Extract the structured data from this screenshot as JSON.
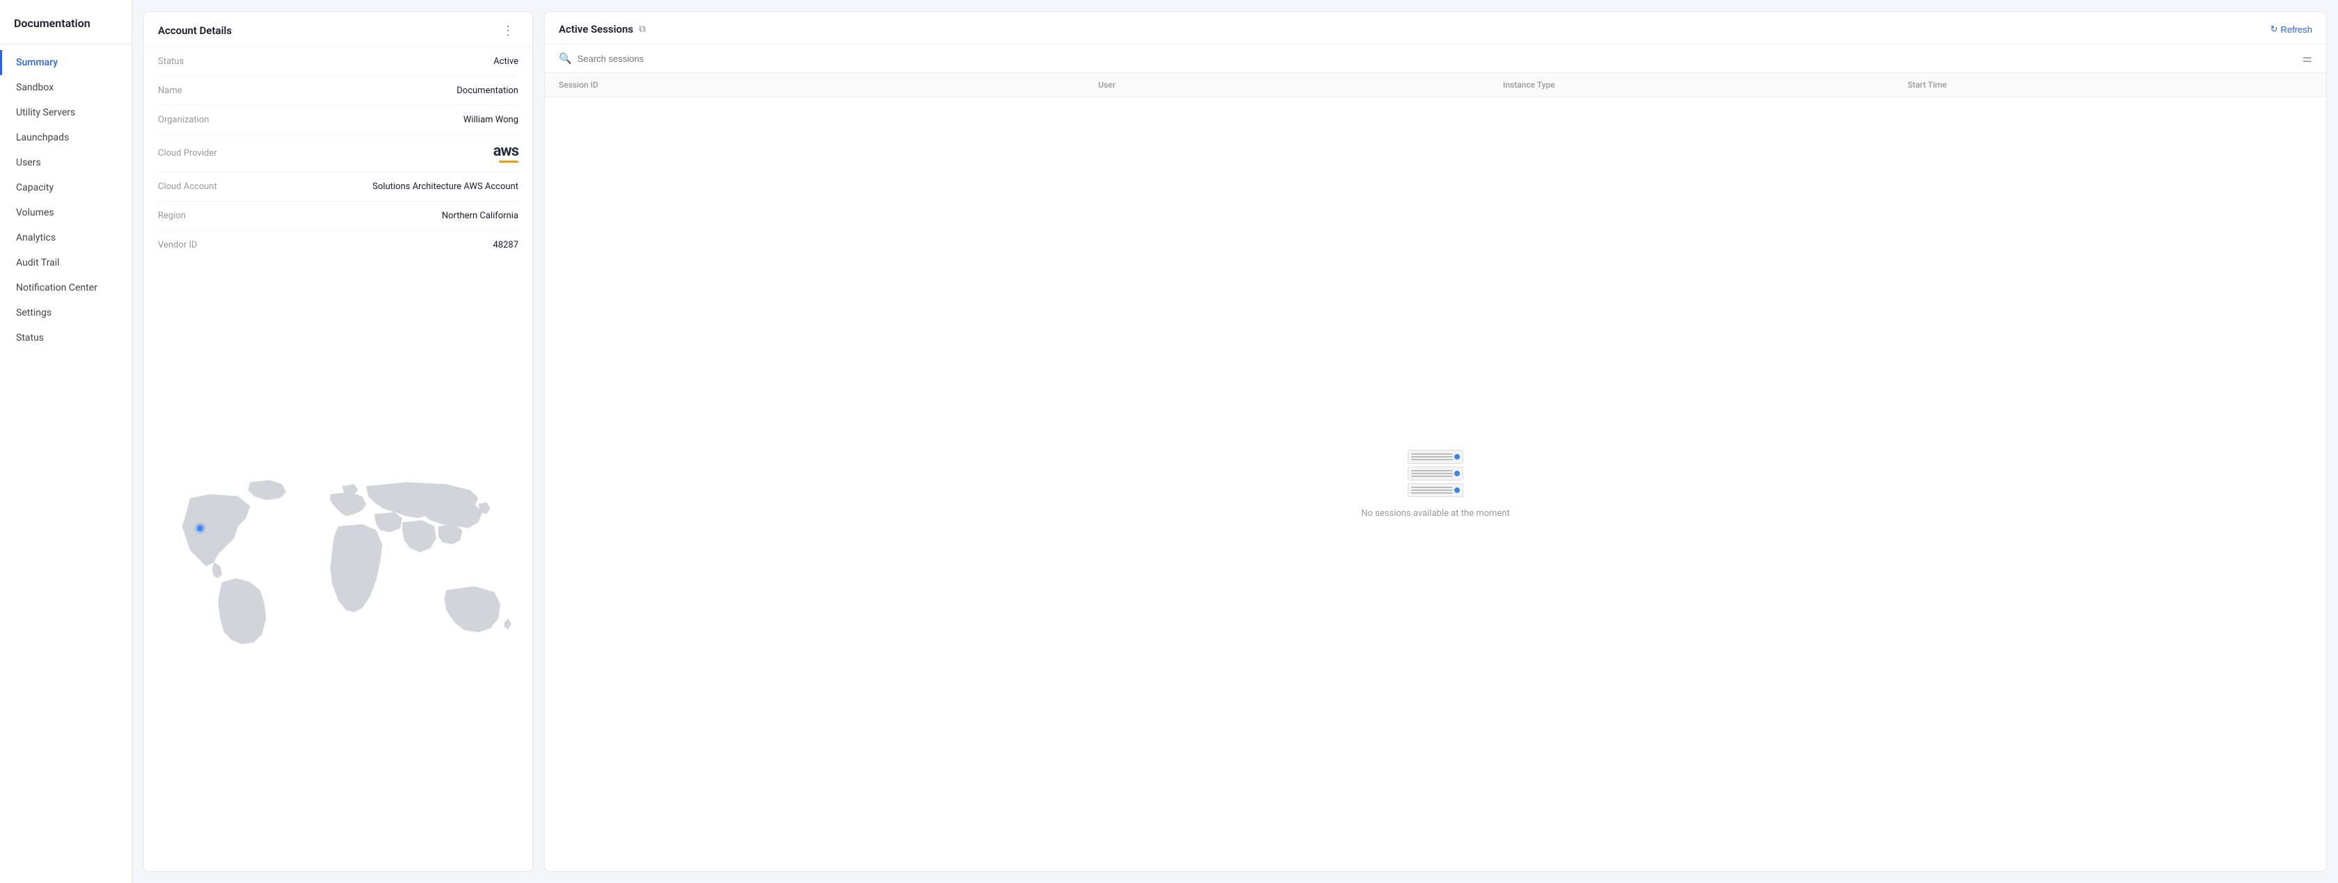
{
  "sidebar": {
    "title": "Documentation",
    "items": [
      {
        "id": "summary",
        "label": "Summary",
        "active": true
      },
      {
        "id": "sandbox",
        "label": "Sandbox",
        "active": false
      },
      {
        "id": "utility-servers",
        "label": "Utility Servers",
        "active": false
      },
      {
        "id": "launchpads",
        "label": "Launchpads",
        "active": false
      },
      {
        "id": "users",
        "label": "Users",
        "active": false
      },
      {
        "id": "capacity",
        "label": "Capacity",
        "active": false
      },
      {
        "id": "volumes",
        "label": "Volumes",
        "active": false
      },
      {
        "id": "analytics",
        "label": "Analytics",
        "active": false
      },
      {
        "id": "audit-trail",
        "label": "Audit Trail",
        "active": false
      },
      {
        "id": "notification-center",
        "label": "Notification Center",
        "active": false
      },
      {
        "id": "settings",
        "label": "Settings",
        "active": false
      },
      {
        "id": "status",
        "label": "Status",
        "active": false
      }
    ]
  },
  "account_details": {
    "panel_title": "Account Details",
    "fields": [
      {
        "label": "Status",
        "value": "Active"
      },
      {
        "label": "Name",
        "value": "Documentation"
      },
      {
        "label": "Organization",
        "value": "William Wong"
      },
      {
        "label": "Cloud Provider",
        "value": "aws"
      },
      {
        "label": "Cloud Account",
        "value": "Solutions Architecture AWS Account"
      },
      {
        "label": "Region",
        "value": "Northern California"
      },
      {
        "label": "Vendor ID",
        "value": "48287"
      }
    ]
  },
  "active_sessions": {
    "panel_title": "Active Sessions",
    "refresh_label": "Refresh",
    "search_placeholder": "Search sessions",
    "columns": [
      {
        "id": "session-id",
        "label": "Session ID"
      },
      {
        "id": "user",
        "label": "User"
      },
      {
        "id": "instance-type",
        "label": "Instance Type"
      },
      {
        "id": "start-time",
        "label": "Start Time"
      }
    ],
    "empty_message": "No sessions available at the moment"
  }
}
